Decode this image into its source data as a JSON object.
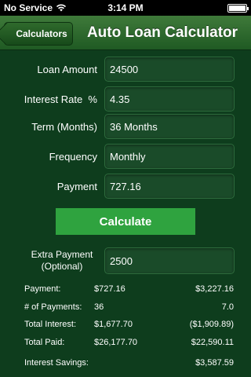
{
  "status_bar": {
    "carrier": "No Service",
    "time": "3:14 PM"
  },
  "nav": {
    "back_label": "Calculators",
    "title": "Auto Loan Calculator"
  },
  "form": {
    "loan_amount_label": "Loan Amount",
    "loan_amount_value": "24500",
    "interest_rate_label": "Interest Rate  %",
    "interest_rate_value": "4.35",
    "term_label": "Term (Months)",
    "term_value": "36 Months",
    "frequency_label": "Frequency",
    "frequency_value": "Monthly",
    "payment_label": "Payment",
    "payment_value": "727.16",
    "calculate_label": "Calculate",
    "extra_label_line1": "Extra Payment",
    "extra_label_line2": "(Optional)",
    "extra_value": "2500"
  },
  "results": {
    "payment": {
      "label": "Payment:",
      "v1": "$727.16",
      "v2": "$3,227.16"
    },
    "num_payments": {
      "label": "# of Payments:",
      "v1": "36",
      "v2": "7.0"
    },
    "total_interest": {
      "label": "Total Interest:",
      "v1": "$1,677.70",
      "v2": "($1,909.89)"
    },
    "total_paid": {
      "label": "Total Paid:",
      "v1": "$26,177.70",
      "v2": "$22,590.11"
    },
    "interest_savings": {
      "label": "Interest Savings:",
      "v2": "$3,587.59"
    }
  },
  "colors": {
    "background": "#0e3d1d",
    "nav_bar": "#2f6a2c",
    "calculate_button": "#2fa33f"
  }
}
